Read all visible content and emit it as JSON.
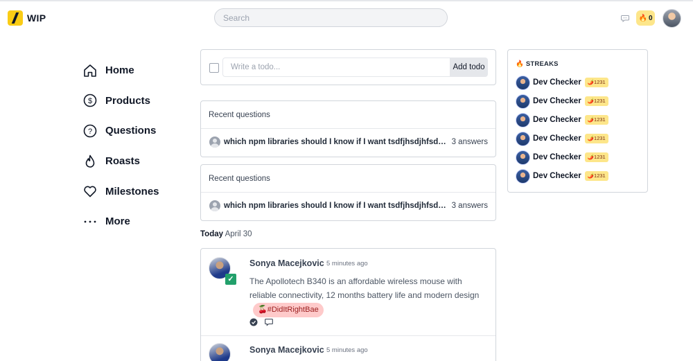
{
  "app": {
    "name": "WIP"
  },
  "header": {
    "search_placeholder": "Search",
    "streak_count": "0",
    "streak_emoji": "🔥"
  },
  "nav": {
    "items": [
      {
        "label": "Home",
        "icon": "home-icon"
      },
      {
        "label": "Products",
        "icon": "dollar-icon"
      },
      {
        "label": "Questions",
        "icon": "question-icon"
      },
      {
        "label": "Roasts",
        "icon": "flame-icon"
      },
      {
        "label": "Milestones",
        "icon": "heart-icon"
      },
      {
        "label": "More",
        "icon": "more-icon"
      }
    ]
  },
  "todo": {
    "placeholder": "Write a todo...",
    "button_label": "Add todo"
  },
  "questions": [
    {
      "heading": "Recent questions",
      "title": "which npm libraries should I know if I want tsdfjhsdjhfsdkjhd...",
      "answers": "3 answers"
    },
    {
      "heading": "Recent questions",
      "title": "which npm libraries should I know if I want tsdfjhsdjhfsdkjhd...",
      "answers": "3 answers"
    }
  ],
  "feed": {
    "day_label": "Today",
    "date_label": "April 30",
    "posts": [
      {
        "author": "Sonya Macejkovic",
        "time": "5 minutes ago",
        "body": "The Apollotech B340 is an affordable wireless mouse with reliable connectivity, 12 months battery life and modern design",
        "tag": "🍒#DidItRightBae",
        "done_mark": "✓"
      },
      {
        "author": "Sonya Macejkovic",
        "time": "5 minutes ago"
      }
    ]
  },
  "streaks": {
    "title": "STREAKS",
    "title_emoji": "🔥",
    "users": [
      {
        "name": "Dev Checker",
        "badge": "🌶️1231"
      },
      {
        "name": "Dev Checker",
        "badge": "🌶️1231"
      },
      {
        "name": "Dev Checker",
        "badge": "🌶️1231"
      },
      {
        "name": "Dev Checker",
        "badge": "🌶️1231"
      },
      {
        "name": "Dev Checker",
        "badge": "🌶️1231"
      },
      {
        "name": "Dev Checker",
        "badge": "🌶️1231"
      }
    ]
  }
}
